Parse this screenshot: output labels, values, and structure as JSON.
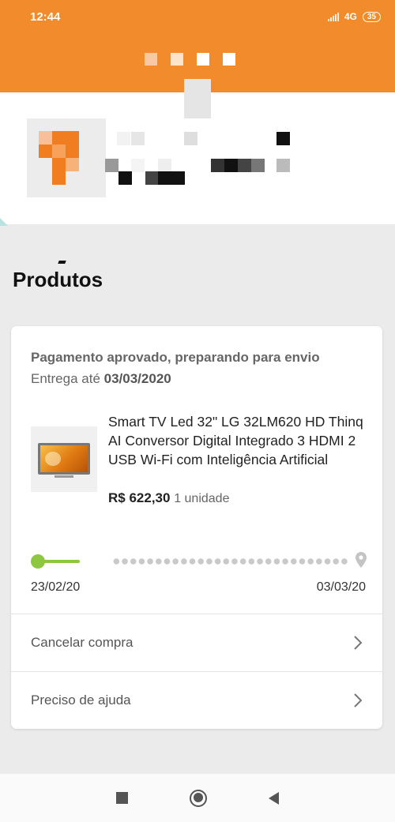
{
  "status_bar": {
    "time": "12:44",
    "network": "4G",
    "battery": "35"
  },
  "section_title": "Produtos",
  "order": {
    "status": "Pagamento aprovado, preparando para envio",
    "delivery_prefix": "Entrega até",
    "delivery_date": "03/03/2020",
    "product": {
      "name": "Smart TV Led 32\" LG 32LM620 HD Thinq AI Conversor Digital Integrado 3 HDMI 2 USB Wi-Fi com Inteligência Artificial",
      "price": "R$ 622,30",
      "quantity": "1 unidade"
    },
    "tracking": {
      "start_date": "23/02/20",
      "end_date": "03/03/20",
      "progress": 0.2
    },
    "actions": {
      "cancel_label": "Cancelar compra",
      "help_label": "Preciso de ajuda"
    }
  },
  "colors": {
    "header": "#f28b2c",
    "progress": "#8dc63f",
    "logo": "#f07d1f"
  },
  "icons": {
    "chevron": "chevron-right-icon",
    "pin": "location-pin-icon"
  }
}
